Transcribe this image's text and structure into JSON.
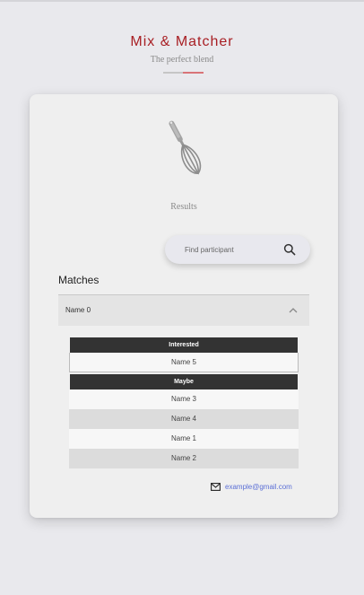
{
  "header": {
    "title": "Mix & Matcher",
    "tagline": "The perfect blend",
    "accent_color": "#a81f24"
  },
  "card": {
    "icon": "whisk-icon",
    "section_label": "Results",
    "search": {
      "placeholder": "Find participant",
      "value": "",
      "icon": "search-icon"
    },
    "matches_heading": "Matches",
    "accordion": {
      "name": "Name 0",
      "expanded": true,
      "icon": "chevron-up-icon",
      "groups": [
        {
          "label": "Interested",
          "names": [
            "Name 5"
          ]
        },
        {
          "label": "Maybe",
          "names": [
            "Name 3",
            "Name 4",
            "Name 1",
            "Name 2"
          ]
        }
      ]
    },
    "contact": {
      "icon": "mail-icon",
      "email": "example@gmail.com",
      "link_color": "#5b6fd6"
    }
  }
}
